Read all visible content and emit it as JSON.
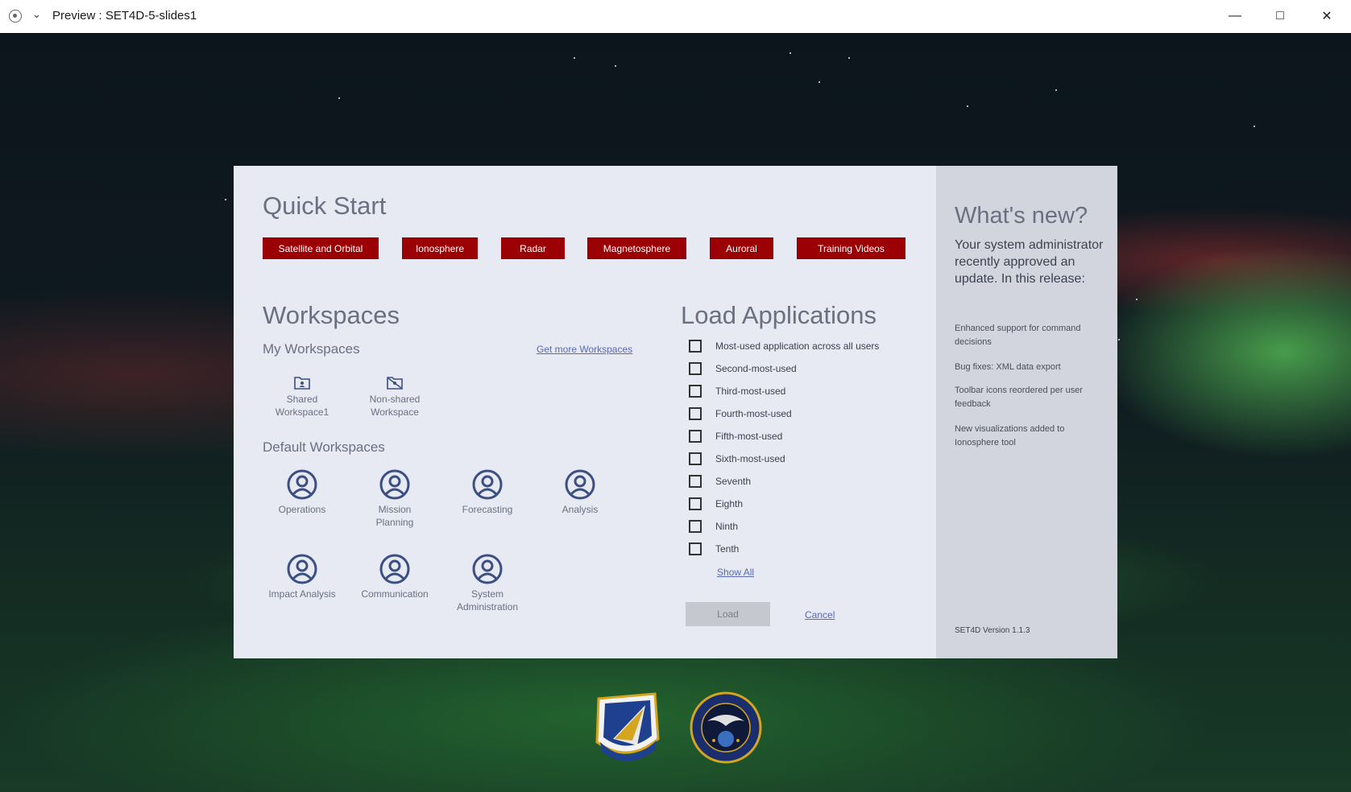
{
  "window": {
    "title": "Preview : SET4D-5-slides1"
  },
  "quick_start": {
    "heading": "Quick Start",
    "buttons": [
      "Satellite and Orbital",
      "Ionosphere",
      "Radar",
      "Magnetosphere",
      "Auroral",
      "Training Videos"
    ]
  },
  "workspaces": {
    "heading": "Workspaces",
    "my_heading": "My Workspaces",
    "get_more": "Get more Workspaces",
    "my_items": [
      {
        "line1": "Shared",
        "line2": "Workspace1",
        "icon": "folder-shared-icon"
      },
      {
        "line1": "Non-shared",
        "line2": "Workspace",
        "icon": "folder-off-icon"
      }
    ],
    "default_heading": "Default Workspaces",
    "default_items": [
      {
        "line1": "Operations",
        "line2": "",
        "icon": "user-circle-icon"
      },
      {
        "line1": "Mission",
        "line2": "Planning",
        "icon": "user-circle-icon"
      },
      {
        "line1": "Forecasting",
        "line2": "",
        "icon": "user-circle-icon"
      },
      {
        "line1": "Analysis",
        "line2": "",
        "icon": "user-circle-icon"
      },
      {
        "line1": "Impact Analysis",
        "line2": "",
        "icon": "user-circle-icon"
      },
      {
        "line1": "Communication",
        "line2": "",
        "icon": "user-circle-icon"
      },
      {
        "line1": "System",
        "line2": "Administration",
        "icon": "user-circle-icon"
      }
    ]
  },
  "load_apps": {
    "heading": "Load Applications",
    "items": [
      "Most-used application across all users",
      "Second-most-used",
      "Third-most-used",
      "Fourth-most-used",
      "Fifth-most-used",
      "Sixth-most-used",
      "Seventh",
      "Eighth",
      "Ninth",
      "Tenth"
    ],
    "show_all": "Show All",
    "load_label": "Load",
    "cancel_label": "Cancel"
  },
  "whats_new": {
    "heading": "What's new?",
    "intro": "Your system administrator recently approved an update. In this release:",
    "notes": [
      "Enhanced support for command decisions",
      "Bug fixes: XML data export",
      "Toolbar icons reordered per user feedback",
      "New visualizations added to Ionosphere tool"
    ],
    "version": "SET4D Version 1.1.3"
  },
  "colors": {
    "accent": "#9b0005",
    "panel": "#e7e9f3",
    "sidebar": "#d3d5de",
    "icon": "#3b4f82"
  }
}
